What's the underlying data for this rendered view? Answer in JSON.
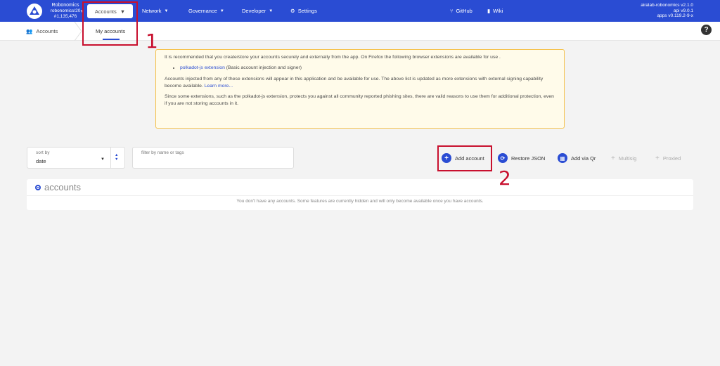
{
  "topbar": {
    "chain_name": "Robonomics",
    "chain_spec": "robonomics/20",
    "block": "#1,135,476",
    "nav": {
      "accounts": "Accounts",
      "network": "Network",
      "governance": "Governance",
      "developer": "Developer",
      "settings": "Settings",
      "github": "GitHub",
      "wiki": "Wiki"
    },
    "versions": {
      "node": "airalab-robonomics v2.1.0",
      "api": "api v9.0.1",
      "apps": "apps v0.119.2-9-x"
    }
  },
  "subnav": {
    "section": "Accounts",
    "tab": "My accounts"
  },
  "notice": {
    "intro": "It is recommended that you create/store your accounts securely and externally from the app. On Firefox the following browser extensions are available for use .",
    "extension_link": "polkadot-js extension",
    "extension_desc": "(Basic account injection and signer)",
    "injected": "Accounts injected from any of these extensions will appear in this application and be available for use. The above list is updated as more extensions with external signing capability become available.",
    "learn_more": "Learn more...",
    "phishing": "Since some extensions, such as the polkadot-js extension, protects you against all community reported phishing sites, there are valid reasons to use them for additional protection, even if you are not storing accounts in it."
  },
  "controls": {
    "sort_label": "sort by",
    "sort_value": "date",
    "filter_placeholder": "filter by name or tags",
    "add_account": "Add account",
    "restore_json": "Restore JSON",
    "add_via_qr": "Add via Qr",
    "multisig": "Multisig",
    "proxied": "Proxied"
  },
  "accounts": {
    "title": "accounts",
    "empty": "You don't have any accounts. Some features are currently hidden and will only become available once you have accounts."
  },
  "annotations": {
    "one": "1",
    "two": "2",
    "color": "#c8102e"
  },
  "colors": {
    "topbar": "#2a4cd3",
    "notice_bg": "#fffbea",
    "notice_border": "#f5c14a"
  }
}
